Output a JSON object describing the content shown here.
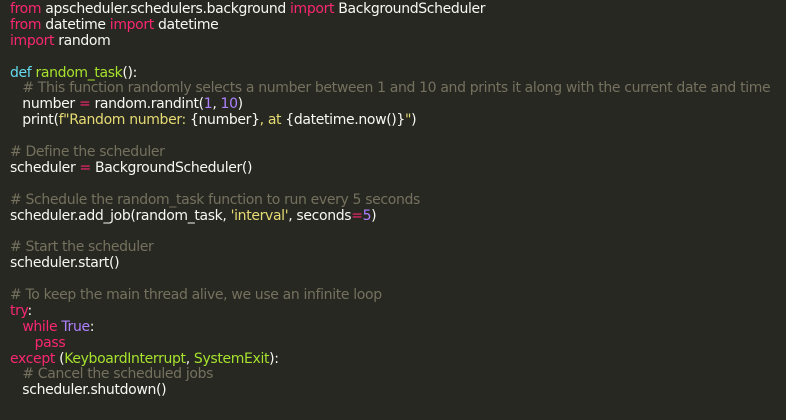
{
  "colors": {
    "background": "#272822",
    "plain": "#f8f8f2",
    "keyword": "#f92672",
    "function_name": "#a6e22e",
    "builtin": "#66d9ef",
    "string": "#e6db74",
    "number": "#ae81ff",
    "comment": "#75715e"
  },
  "code": {
    "lines": [
      [
        [
          "kw",
          "from"
        ],
        [
          "p",
          " apscheduler.schedulers.background "
        ],
        [
          "kw",
          "import"
        ],
        [
          "p",
          " BackgroundScheduler"
        ]
      ],
      [
        [
          "kw",
          "from"
        ],
        [
          "p",
          " datetime "
        ],
        [
          "kw",
          "import"
        ],
        [
          "p",
          " datetime"
        ]
      ],
      [
        [
          "kw",
          "import"
        ],
        [
          "p",
          " random"
        ]
      ],
      [],
      [
        [
          "bi",
          "def"
        ],
        [
          "p",
          " "
        ],
        [
          "fn",
          "random_task"
        ],
        [
          "p",
          "():"
        ]
      ],
      [
        [
          "p",
          "   "
        ],
        [
          "cm",
          "# This function randomly selects a number between 1 and 10 and prints it along with the current date and time"
        ]
      ],
      [
        [
          "p",
          "   number "
        ],
        [
          "kw",
          "="
        ],
        [
          "p",
          " random.randint("
        ],
        [
          "num",
          "1"
        ],
        [
          "p",
          ", "
        ],
        [
          "num",
          "10"
        ],
        [
          "p",
          ")"
        ]
      ],
      [
        [
          "p",
          "   print("
        ],
        [
          "str",
          "f\"Random number: "
        ],
        [
          "p",
          "{number}"
        ],
        [
          "str",
          ", at "
        ],
        [
          "p",
          "{datetime.now()}"
        ],
        [
          "str",
          "\""
        ],
        [
          "p",
          ")"
        ]
      ],
      [],
      [
        [
          "cm",
          "# Define the scheduler"
        ]
      ],
      [
        [
          "p",
          "scheduler "
        ],
        [
          "kw",
          "="
        ],
        [
          "p",
          " BackgroundScheduler()"
        ]
      ],
      [],
      [
        [
          "cm",
          "# Schedule the random_task function to run every 5 seconds"
        ]
      ],
      [
        [
          "p",
          "scheduler.add_job(random_task, "
        ],
        [
          "str",
          "'interval'"
        ],
        [
          "p",
          ", seconds"
        ],
        [
          "kw",
          "="
        ],
        [
          "num",
          "5"
        ],
        [
          "p",
          ")"
        ]
      ],
      [],
      [
        [
          "cm",
          "# Start the scheduler"
        ]
      ],
      [
        [
          "p",
          "scheduler.start()"
        ]
      ],
      [],
      [
        [
          "cm",
          "# To keep the main thread alive, we use an infinite loop"
        ]
      ],
      [
        [
          "kw",
          "try"
        ],
        [
          "p",
          ":"
        ]
      ],
      [
        [
          "p",
          "   "
        ],
        [
          "kw",
          "while"
        ],
        [
          "p",
          " "
        ],
        [
          "num",
          "True"
        ],
        [
          "p",
          ":"
        ]
      ],
      [
        [
          "p",
          "      "
        ],
        [
          "kw",
          "pass"
        ]
      ],
      [
        [
          "kw",
          "except"
        ],
        [
          "p",
          " ("
        ],
        [
          "fn",
          "KeyboardInterrupt"
        ],
        [
          "p",
          ", "
        ],
        [
          "fn",
          "SystemExit"
        ],
        [
          "p",
          "):"
        ]
      ],
      [
        [
          "p",
          "   "
        ],
        [
          "cm",
          "# Cancel the scheduled jobs"
        ]
      ],
      [
        [
          "p",
          "   scheduler.shutdown()"
        ]
      ]
    ]
  }
}
